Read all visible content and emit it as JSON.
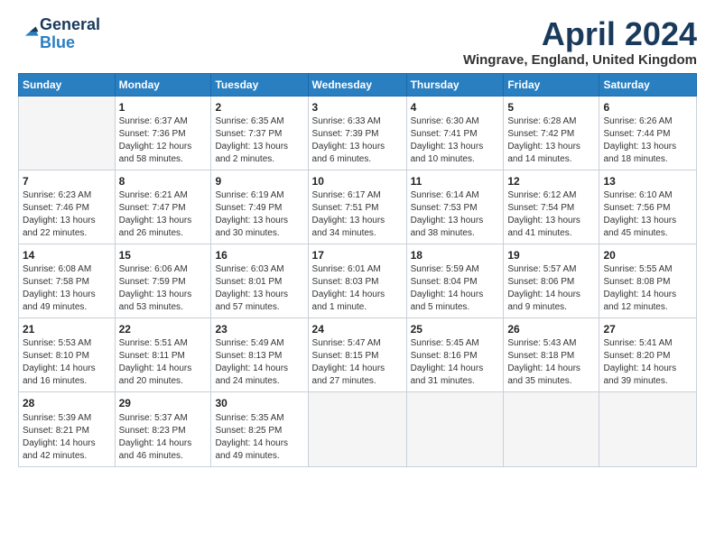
{
  "logo": {
    "general": "General",
    "blue": "Blue"
  },
  "header": {
    "month": "April 2024",
    "location": "Wingrave, England, United Kingdom"
  },
  "weekdays": [
    "Sunday",
    "Monday",
    "Tuesday",
    "Wednesday",
    "Thursday",
    "Friday",
    "Saturday"
  ],
  "weeks": [
    [
      {
        "day": "",
        "info": ""
      },
      {
        "day": "1",
        "info": "Sunrise: 6:37 AM\nSunset: 7:36 PM\nDaylight: 12 hours\nand 58 minutes."
      },
      {
        "day": "2",
        "info": "Sunrise: 6:35 AM\nSunset: 7:37 PM\nDaylight: 13 hours\nand 2 minutes."
      },
      {
        "day": "3",
        "info": "Sunrise: 6:33 AM\nSunset: 7:39 PM\nDaylight: 13 hours\nand 6 minutes."
      },
      {
        "day": "4",
        "info": "Sunrise: 6:30 AM\nSunset: 7:41 PM\nDaylight: 13 hours\nand 10 minutes."
      },
      {
        "day": "5",
        "info": "Sunrise: 6:28 AM\nSunset: 7:42 PM\nDaylight: 13 hours\nand 14 minutes."
      },
      {
        "day": "6",
        "info": "Sunrise: 6:26 AM\nSunset: 7:44 PM\nDaylight: 13 hours\nand 18 minutes."
      }
    ],
    [
      {
        "day": "7",
        "info": "Sunrise: 6:23 AM\nSunset: 7:46 PM\nDaylight: 13 hours\nand 22 minutes."
      },
      {
        "day": "8",
        "info": "Sunrise: 6:21 AM\nSunset: 7:47 PM\nDaylight: 13 hours\nand 26 minutes."
      },
      {
        "day": "9",
        "info": "Sunrise: 6:19 AM\nSunset: 7:49 PM\nDaylight: 13 hours\nand 30 minutes."
      },
      {
        "day": "10",
        "info": "Sunrise: 6:17 AM\nSunset: 7:51 PM\nDaylight: 13 hours\nand 34 minutes."
      },
      {
        "day": "11",
        "info": "Sunrise: 6:14 AM\nSunset: 7:53 PM\nDaylight: 13 hours\nand 38 minutes."
      },
      {
        "day": "12",
        "info": "Sunrise: 6:12 AM\nSunset: 7:54 PM\nDaylight: 13 hours\nand 41 minutes."
      },
      {
        "day": "13",
        "info": "Sunrise: 6:10 AM\nSunset: 7:56 PM\nDaylight: 13 hours\nand 45 minutes."
      }
    ],
    [
      {
        "day": "14",
        "info": "Sunrise: 6:08 AM\nSunset: 7:58 PM\nDaylight: 13 hours\nand 49 minutes."
      },
      {
        "day": "15",
        "info": "Sunrise: 6:06 AM\nSunset: 7:59 PM\nDaylight: 13 hours\nand 53 minutes."
      },
      {
        "day": "16",
        "info": "Sunrise: 6:03 AM\nSunset: 8:01 PM\nDaylight: 13 hours\nand 57 minutes."
      },
      {
        "day": "17",
        "info": "Sunrise: 6:01 AM\nSunset: 8:03 PM\nDaylight: 14 hours\nand 1 minute."
      },
      {
        "day": "18",
        "info": "Sunrise: 5:59 AM\nSunset: 8:04 PM\nDaylight: 14 hours\nand 5 minutes."
      },
      {
        "day": "19",
        "info": "Sunrise: 5:57 AM\nSunset: 8:06 PM\nDaylight: 14 hours\nand 9 minutes."
      },
      {
        "day": "20",
        "info": "Sunrise: 5:55 AM\nSunset: 8:08 PM\nDaylight: 14 hours\nand 12 minutes."
      }
    ],
    [
      {
        "day": "21",
        "info": "Sunrise: 5:53 AM\nSunset: 8:10 PM\nDaylight: 14 hours\nand 16 minutes."
      },
      {
        "day": "22",
        "info": "Sunrise: 5:51 AM\nSunset: 8:11 PM\nDaylight: 14 hours\nand 20 minutes."
      },
      {
        "day": "23",
        "info": "Sunrise: 5:49 AM\nSunset: 8:13 PM\nDaylight: 14 hours\nand 24 minutes."
      },
      {
        "day": "24",
        "info": "Sunrise: 5:47 AM\nSunset: 8:15 PM\nDaylight: 14 hours\nand 27 minutes."
      },
      {
        "day": "25",
        "info": "Sunrise: 5:45 AM\nSunset: 8:16 PM\nDaylight: 14 hours\nand 31 minutes."
      },
      {
        "day": "26",
        "info": "Sunrise: 5:43 AM\nSunset: 8:18 PM\nDaylight: 14 hours\nand 35 minutes."
      },
      {
        "day": "27",
        "info": "Sunrise: 5:41 AM\nSunset: 8:20 PM\nDaylight: 14 hours\nand 39 minutes."
      }
    ],
    [
      {
        "day": "28",
        "info": "Sunrise: 5:39 AM\nSunset: 8:21 PM\nDaylight: 14 hours\nand 42 minutes."
      },
      {
        "day": "29",
        "info": "Sunrise: 5:37 AM\nSunset: 8:23 PM\nDaylight: 14 hours\nand 46 minutes."
      },
      {
        "day": "30",
        "info": "Sunrise: 5:35 AM\nSunset: 8:25 PM\nDaylight: 14 hours\nand 49 minutes."
      },
      {
        "day": "",
        "info": ""
      },
      {
        "day": "",
        "info": ""
      },
      {
        "day": "",
        "info": ""
      },
      {
        "day": "",
        "info": ""
      }
    ]
  ]
}
